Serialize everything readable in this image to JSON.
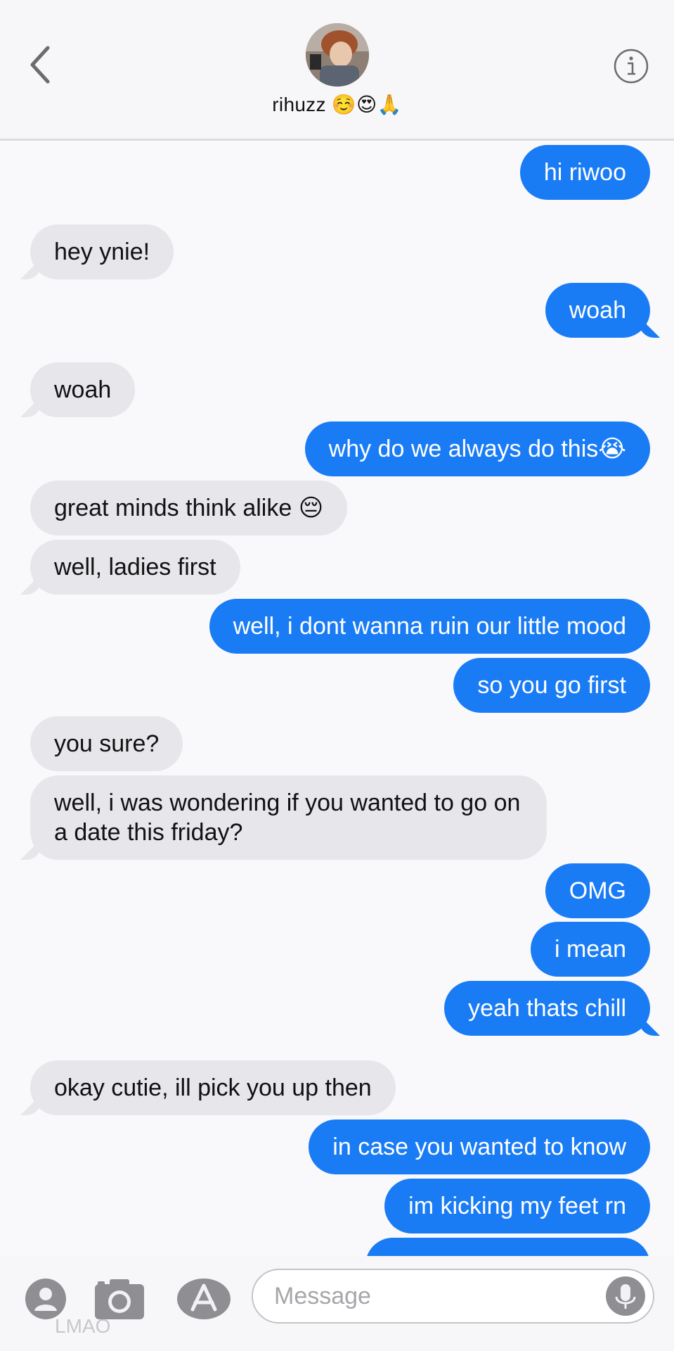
{
  "header": {
    "contact_name": "rihuzz ☺️😍🙏",
    "back_icon": "chevron-left-icon",
    "info_icon": "info-icon"
  },
  "messages": [
    {
      "from": "me",
      "text": "hi riwoo"
    },
    {
      "from": "them",
      "text": "hey ynie!"
    },
    {
      "from": "me",
      "text": "woah"
    },
    {
      "from": "them",
      "text": "woah"
    },
    {
      "from": "me",
      "text": "why do we always do this😭"
    },
    {
      "from": "them",
      "text": "great minds think alike 😔"
    },
    {
      "from": "them",
      "text": "well, ladies first"
    },
    {
      "from": "me",
      "text": "well, i dont wanna ruin our little mood"
    },
    {
      "from": "me",
      "text": "so you go first"
    },
    {
      "from": "them",
      "text": "you sure?"
    },
    {
      "from": "them",
      "text": "well, i was wondering if you wanted to go on a date this friday?"
    },
    {
      "from": "me",
      "text": "OMG"
    },
    {
      "from": "me",
      "text": "i mean"
    },
    {
      "from": "me",
      "text": "yeah thats chill"
    },
    {
      "from": "them",
      "text": "okay cutie, ill pick you up then"
    },
    {
      "from": "me",
      "text": "in case you wanted to know"
    },
    {
      "from": "me",
      "text": "im kicking my feet rn"
    }
  ],
  "composer": {
    "placeholder": "Message",
    "icons": [
      "contact-icon",
      "camera-icon",
      "app-store-icon",
      "mic-icon"
    ],
    "faded_text": "LMAO"
  },
  "colors": {
    "sent_bubble": "#1a7cf5",
    "received_bubble": "#e6e6eb",
    "background": "#f9f9fb"
  }
}
